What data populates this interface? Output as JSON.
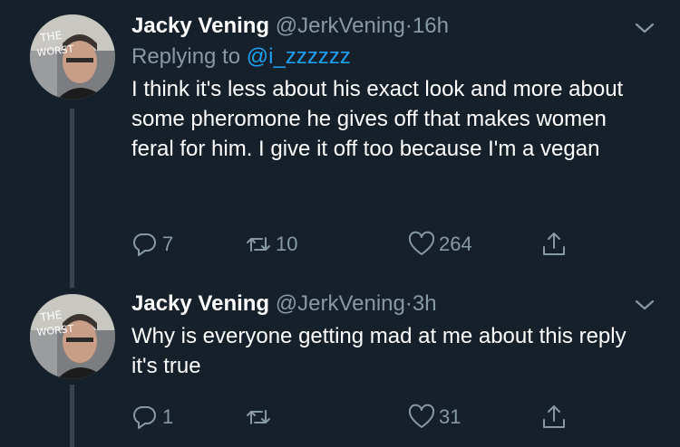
{
  "tweets": [
    {
      "name": "Jacky Vening",
      "handle": "@JerkVening",
      "separator": "·",
      "time": "16h",
      "reply_prefix": "Replying to",
      "reply_to": "@i_zzzzzz",
      "text": "I think it's less about his exact look and more about some pheromone he gives off that makes women feral for him. I give it off too because I'm a vegan",
      "reply_count": "7",
      "retweet_count": "10",
      "like_count": "264"
    },
    {
      "name": "Jacky Vening",
      "handle": "@JerkVening",
      "separator": "·",
      "time": "3h",
      "text": "Why is everyone getting mad at me about this reply it's true",
      "reply_count": "1",
      "retweet_count": "",
      "like_count": "31"
    }
  ],
  "avatar_text": "THE WORST",
  "colors": {
    "background": "#15202b",
    "secondary_text": "#8899a6",
    "link": "#1da1f2",
    "thread_line": "#38444d"
  },
  "icons": {
    "reply": "reply-icon",
    "retweet": "retweet-icon",
    "like": "like-icon",
    "share": "share-icon",
    "menu": "chevron-down-icon"
  }
}
